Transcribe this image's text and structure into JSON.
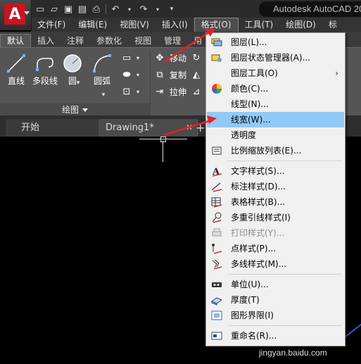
{
  "app_title": "Autodesk AutoCAD 20",
  "quick_access": {
    "icons": [
      "new-icon",
      "open-icon",
      "save-icon",
      "saveas-icon",
      "print-icon",
      "undo-icon",
      "redo-icon"
    ]
  },
  "menubar": {
    "items": [
      {
        "label": "文件(F)"
      },
      {
        "label": "编辑(E)"
      },
      {
        "label": "视图(V)"
      },
      {
        "label": "插入(I)"
      },
      {
        "label": "格式(O)"
      },
      {
        "label": "工具(T)"
      },
      {
        "label": "绘图(D)"
      },
      {
        "label": "标"
      }
    ]
  },
  "ribbon_tabs": [
    {
      "label": "默认"
    },
    {
      "label": "插入"
    },
    {
      "label": "注释"
    },
    {
      "label": "参数化"
    },
    {
      "label": "视图"
    },
    {
      "label": "管理"
    },
    {
      "label": "用"
    }
  ],
  "ribbon": {
    "draw_tools": [
      {
        "label": "直线"
      },
      {
        "label": "多段线"
      },
      {
        "label": "圆"
      },
      {
        "label": "圆弧"
      }
    ],
    "panel_title": "绘图",
    "modify_tools": [
      {
        "label": "移动"
      },
      {
        "label": "复制"
      },
      {
        "label": "拉伸"
      }
    ]
  },
  "doc_tabs": [
    {
      "label": "开始"
    },
    {
      "label": "Drawing1*"
    }
  ],
  "format_menu": {
    "items": [
      {
        "label": "图层(L)...",
        "icon": "layer-icon",
        "enabled": true
      },
      {
        "label": "图层状态管理器(A)...",
        "icon": "layer-state-icon",
        "enabled": true
      },
      {
        "label": "图层工具(O)",
        "icon": "",
        "enabled": true,
        "submenu": "›"
      },
      {
        "label": "颜色(C)...",
        "icon": "color-wheel-icon",
        "enabled": true
      },
      {
        "label": "线型(N)...",
        "icon": "",
        "enabled": true
      },
      {
        "label": "线宽(W)...",
        "icon": "",
        "enabled": true,
        "highlighted": true
      },
      {
        "label": "透明度",
        "icon": "",
        "enabled": true
      },
      {
        "label": "比例缩放列表(E)...",
        "icon": "scale-list-icon",
        "enabled": true
      },
      {
        "label": "文字样式(S)...",
        "icon": "text-style-icon",
        "enabled": true
      },
      {
        "label": "标注样式(D)...",
        "icon": "dim-style-icon",
        "enabled": true
      },
      {
        "label": "表格样式(B)...",
        "icon": "table-style-icon",
        "enabled": true
      },
      {
        "label": "多重引线样式(I)",
        "icon": "multileader-style-icon",
        "enabled": true
      },
      {
        "label": "打印样式(Y)...",
        "icon": "plot-style-icon",
        "enabled": false
      },
      {
        "label": "点样式(P)...",
        "icon": "point-style-icon",
        "enabled": true
      },
      {
        "label": "多线样式(M)...",
        "icon": "mline-style-icon",
        "enabled": true
      },
      {
        "label": "单位(U)...",
        "icon": "units-icon",
        "enabled": true
      },
      {
        "label": "厚度(T)",
        "icon": "thickness-icon",
        "enabled": true
      },
      {
        "label": "图形界限(I)",
        "icon": "limits-icon",
        "enabled": true
      },
      {
        "label": "重命名(R)...",
        "icon": "rename-icon",
        "enabled": true
      }
    ]
  },
  "watermark": "jingyan.baidu.com",
  "colors": {
    "highlight": "#91c9f7",
    "arrow": "#e8202a",
    "logo": "#c8141e"
  }
}
